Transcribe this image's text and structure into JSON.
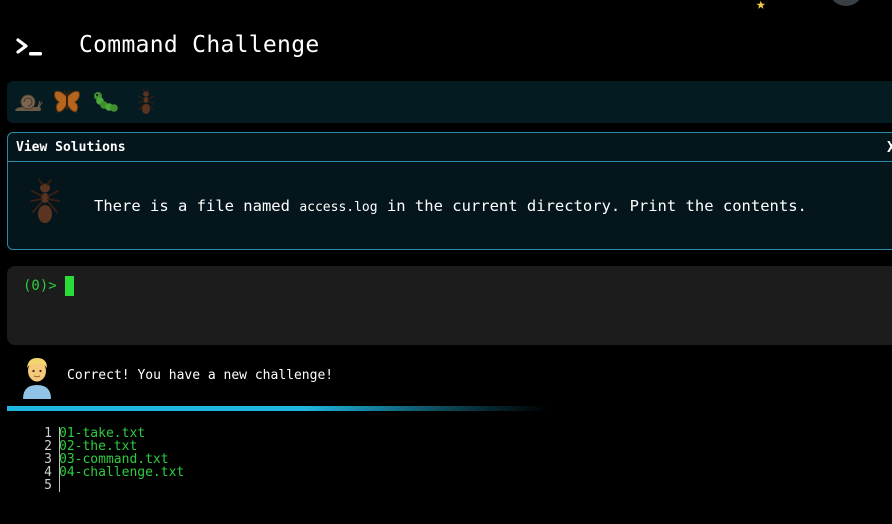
{
  "header": {
    "title": "Command Challenge",
    "logo_icon": "terminal-prompt-icon"
  },
  "levels": {
    "items": [
      {
        "icon": "snail-icon",
        "status": "completed"
      },
      {
        "icon": "butterfly-icon",
        "status": "completed"
      },
      {
        "icon": "caterpillar-icon",
        "status": "completed"
      },
      {
        "icon": "ant-icon",
        "status": "current"
      }
    ]
  },
  "challenge": {
    "view_solutions_label": "View Solutions",
    "close_label": "X",
    "text_before": "There is a file named",
    "code": "access.log",
    "text_after": "in the current directory. Print the contents.",
    "icon": "ant-icon"
  },
  "terminal": {
    "prompt": "(0)>",
    "input_value": ""
  },
  "feedback": {
    "message": "Correct! You have a new challenge!",
    "icon": "person-icon"
  },
  "listing": {
    "lines": [
      {
        "num": "1",
        "text": "01-take.txt"
      },
      {
        "num": "2",
        "text": "02-the.txt"
      },
      {
        "num": "3",
        "text": "03-command.txt"
      },
      {
        "num": "4",
        "text": "04-challenge.txt"
      },
      {
        "num": "5",
        "text": ""
      }
    ]
  },
  "colors": {
    "accent": "#1fb7e0",
    "prompt_green": "#2ecc40",
    "panel_bg": "#041b22",
    "terminal_bg": "#1c1c1c"
  }
}
